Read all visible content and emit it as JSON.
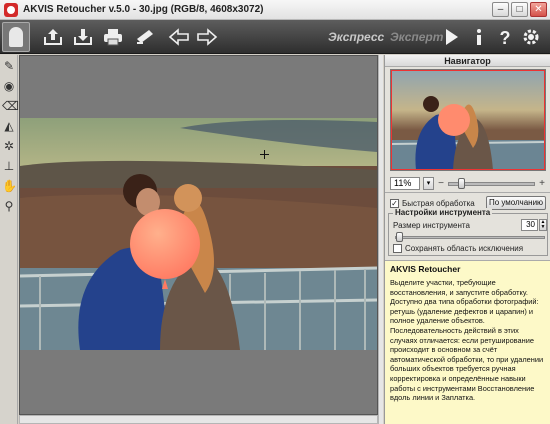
{
  "window": {
    "title": "AKVIS Retoucher v.5.0 - 30.jpg (RGB/8, 4608x3072)",
    "minimize": "–",
    "maximize": "□",
    "close": "✕"
  },
  "toolbar": {
    "icons": [
      "open-icon",
      "save-icon",
      "print-icon",
      "share-icon",
      "undo-icon",
      "redo-icon",
      "run-icon",
      "info-icon",
      "help-icon",
      "settings-icon"
    ],
    "express_label": "Экспресс",
    "expert_label": "Эксперт"
  },
  "tools": [
    "pencil-icon",
    "exclusion-icon",
    "eraser-icon",
    "clone-icon",
    "magic-icon",
    "stamp-icon",
    "hand-icon",
    "zoom-icon"
  ],
  "navigator": {
    "title": "Навигатор",
    "zoom_value": "11%",
    "zoom_minus": "−",
    "zoom_plus": "+",
    "zoom_level": 0.12
  },
  "settings": {
    "quick_label": "Быстрая обработка",
    "quick_checked": "✓",
    "default_button": "По умолчанию",
    "group_title": "Настройки инструмента",
    "size_label": "Размер инструмента",
    "size_value": "30",
    "keep_label": "Сохранять область исключения"
  },
  "help": {
    "title": "AKVIS Retoucher",
    "body": "Выделите участки, требующие восстановления, и запустите обработку. Доступно два типа обработки фотографий: ретушь (удаление дефектов и царапин) и полное удаление объектов. Последовательность действий в этих случаях отличается: если ретуширование происходит в основном за счёт автоматической обработки, то при удалении больших объектов требуется ручная корректировка и определённые навыки работы с инструментами Восстановление вдоль линии и Заплатка."
  },
  "colors": {
    "accent_red": "#e33",
    "help_bg": "#fdf9c8",
    "toolbar_dark": "#2e2e2e"
  }
}
